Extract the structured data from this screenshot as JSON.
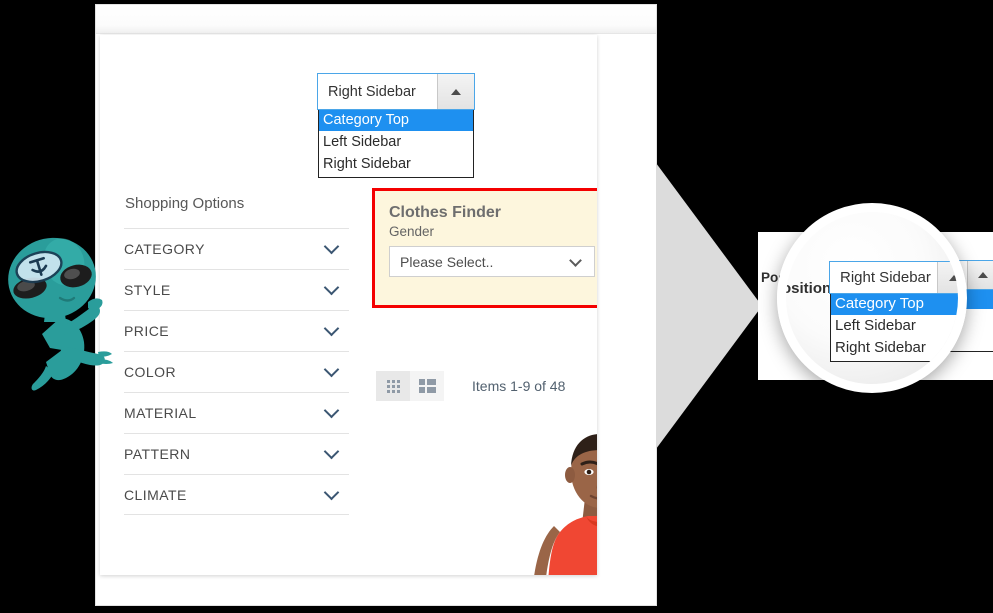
{
  "position_field": {
    "label": "Position",
    "required_marker": "*",
    "selected_value": "Right Sidebar",
    "expanded": true,
    "arrow_icon": "caret-up-icon",
    "options": [
      {
        "label": "Category Top",
        "selected": true
      },
      {
        "label": "Left Sidebar",
        "selected": false
      },
      {
        "label": "Right Sidebar",
        "selected": false
      }
    ]
  },
  "magnified_position_field": {
    "label": "Position",
    "required_marker": "*",
    "selected_value": "Right Sidebar",
    "arrow_icon": "caret-up-icon",
    "options": [
      {
        "label": "Category Top",
        "selected": true
      },
      {
        "label": "Left Sidebar",
        "selected": false
      },
      {
        "label": "Right Sidebar",
        "selected": false
      }
    ]
  },
  "shopping_options": {
    "title": "Shopping Options",
    "filters": [
      {
        "label": "CATEGORY",
        "icon": "chevron-down-icon"
      },
      {
        "label": "STYLE",
        "icon": "chevron-down-icon"
      },
      {
        "label": "PRICE",
        "icon": "chevron-down-icon"
      },
      {
        "label": "COLOR",
        "icon": "chevron-down-icon"
      },
      {
        "label": "MATERIAL",
        "icon": "chevron-down-icon"
      },
      {
        "label": "PATTERN",
        "icon": "chevron-down-icon"
      },
      {
        "label": "CLIMATE",
        "icon": "chevron-down-icon"
      }
    ]
  },
  "clothes_finder": {
    "title": "Clothes Finder",
    "field_label": "Gender",
    "select_placeholder": "Please Select..",
    "select_icon": "chevron-down-icon",
    "highlight_border_color": "#f40000",
    "background_color": "#fdf6dd"
  },
  "toolbar": {
    "view_modes": [
      {
        "name": "grid",
        "icon": "grid-view-icon",
        "active": false
      },
      {
        "name": "list",
        "icon": "list-view-icon",
        "active": true
      }
    ],
    "items_count": "Items 1-9 of 48"
  },
  "product": {
    "alt": "male model wearing red sleeveless tank top",
    "shirt_color": "#f04733"
  },
  "decorations": {
    "arrow_icon": "right-pointing-arrow",
    "arrow_color": "#dcdcdc",
    "magnifier_icon": "magnifier-lens",
    "mascot_icon": "alien-mascot-icon",
    "mascot_color": "#2a9d9b",
    "background_color": "#000000"
  },
  "colors": {
    "select_border_focus": "#4ba6e8",
    "option_highlight": "#1e90f0",
    "required_asterisk": "#e25f28"
  }
}
